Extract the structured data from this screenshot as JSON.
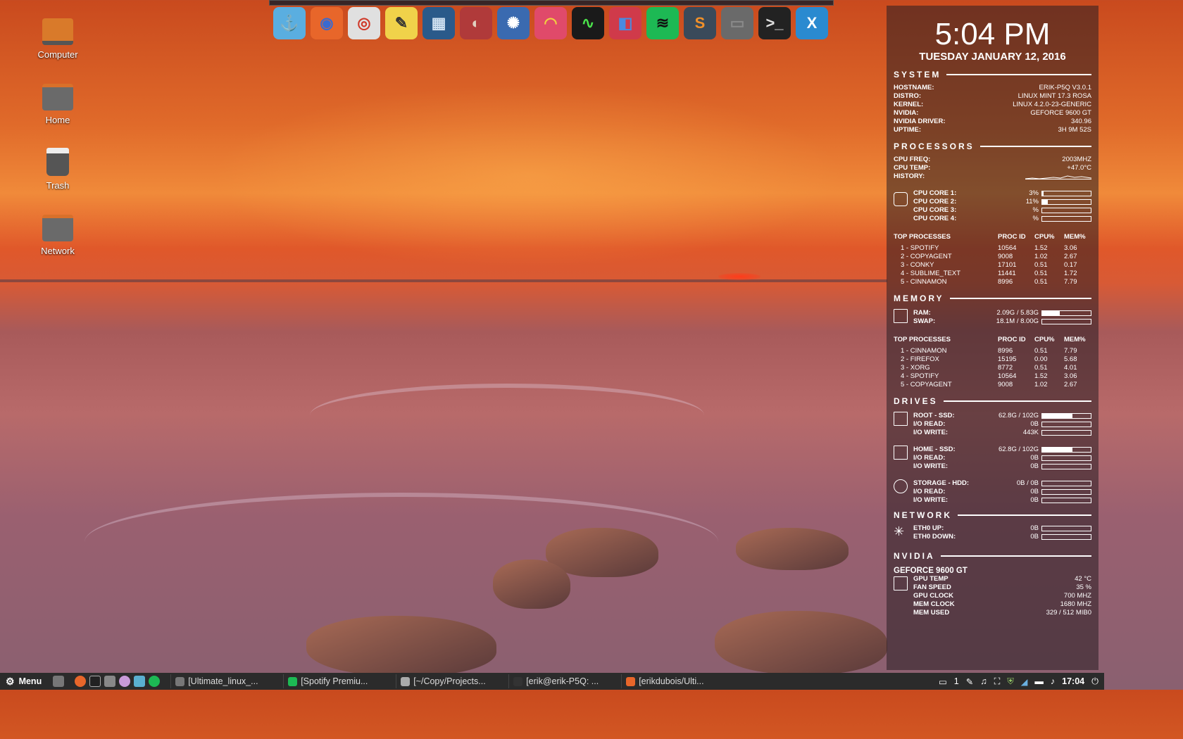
{
  "desktop": {
    "icons": [
      {
        "label": "Computer"
      },
      {
        "label": "Home"
      },
      {
        "label": "Trash"
      },
      {
        "label": "Network"
      }
    ]
  },
  "dock": {
    "icons": [
      {
        "name": "anchor-icon",
        "glyph": "⚓",
        "color": "#5aaee0",
        "fg": "#ffffff"
      },
      {
        "name": "firefox-icon",
        "glyph": "◉",
        "color": "#e8662a",
        "fg": "#3a6ad0"
      },
      {
        "name": "chrome-icon",
        "glyph": "◎",
        "color": "#e0e0e0",
        "fg": "#d03a2a"
      },
      {
        "name": "notes-icon",
        "glyph": "✎",
        "color": "#f0d24a",
        "fg": "#333333"
      },
      {
        "name": "video-icon",
        "glyph": "▦",
        "color": "#2a5a8a",
        "fg": "#cfe0f0"
      },
      {
        "name": "photo-viewer-icon",
        "glyph": "◐",
        "color": "#b03a3a",
        "fg": "#e0d0c0"
      },
      {
        "name": "shutter-icon",
        "glyph": "✺",
        "color": "#3a6ab0",
        "fg": "#ffffff"
      },
      {
        "name": "rainbow-icon",
        "glyph": "◠",
        "color": "#e04a6a",
        "fg": "#f0d040"
      },
      {
        "name": "system-monitor-icon",
        "glyph": "∿",
        "color": "#1a1a1a",
        "fg": "#4ae04a"
      },
      {
        "name": "tools-icon",
        "glyph": "◧",
        "color": "#d03a4a",
        "fg": "#4a8ae0"
      },
      {
        "name": "spotify-icon",
        "glyph": "≋",
        "color": "#1db954",
        "fg": "#111111"
      },
      {
        "name": "sublime-icon",
        "glyph": "S",
        "color": "#3a4a5a",
        "fg": "#f0902a"
      },
      {
        "name": "folder-icon",
        "glyph": "▭",
        "color": "#6a6a6a",
        "fg": "#8a8a8a"
      },
      {
        "name": "terminal-icon",
        "glyph": ">_",
        "color": "#222222",
        "fg": "#e0e0e0"
      },
      {
        "name": "xapp-icon",
        "glyph": "X",
        "color": "#2a8ad0",
        "fg": "#ffffff"
      }
    ]
  },
  "conky": {
    "time": "5:04 PM",
    "date": "TUESDAY JANUARY 12, 2016",
    "system": {
      "title": "SYSTEM",
      "rows": [
        {
          "k": "HOSTNAME:",
          "v": "ERIK-P5Q  V3.0.1"
        },
        {
          "k": "DISTRO:",
          "v": "LINUX MINT 17.3 ROSA"
        },
        {
          "k": "KERNEL:",
          "v": "LINUX 4.2.0-23-GENERIC"
        },
        {
          "k": "NVIDIA:",
          "v": "GEFORCE 9600 GT"
        },
        {
          "k": "NVIDIA DRIVER:",
          "v": "340.96"
        },
        {
          "k": "UPTIME:",
          "v": "3H 9M 52S"
        }
      ]
    },
    "processors": {
      "title": "PROCESSORS",
      "cpu_freq_label": "CPU FREQ:",
      "cpu_freq": "2003MHZ",
      "cpu_temp_label": "CPU TEMP:",
      "cpu_temp": "+47.0°C",
      "history_label": "HISTORY:",
      "cores": [
        {
          "label": "CPU CORE 1:",
          "value": "3%",
          "pct": 3
        },
        {
          "label": "CPU CORE 2:",
          "value": "11%",
          "pct": 11
        },
        {
          "label": "CPU CORE 3:",
          "value": "%",
          "pct": 0
        },
        {
          "label": "CPU CORE 4:",
          "value": "%",
          "pct": 0
        }
      ],
      "top_header": [
        "TOP PROCESSES",
        "PROC ID",
        "CPU%",
        "MEM%"
      ],
      "top": [
        [
          "1 - SPOTIFY",
          "10564",
          "1.52",
          "3.06"
        ],
        [
          "2 - COPYAGENT",
          "9008",
          "1.02",
          "2.67"
        ],
        [
          "3 - CONKY",
          "17101",
          "0.51",
          "0.17"
        ],
        [
          "4 - SUBLIME_TEXT",
          "11441",
          "0.51",
          "1.72"
        ],
        [
          "5 - CINNAMON",
          "8996",
          "0.51",
          "7.79"
        ]
      ]
    },
    "memory": {
      "title": "MEMORY",
      "ram_label": "RAM:",
      "ram": "2.09G / 5.83G",
      "ram_pct": 36,
      "swap_label": "SWAP:",
      "swap": "18.1M / 8.00G",
      "swap_pct": 0,
      "top_header": [
        "TOP PROCESSES",
        "PROC ID",
        "CPU%",
        "MEM%"
      ],
      "top": [
        [
          "1 - CINNAMON",
          "8996",
          "0.51",
          "7.79"
        ],
        [
          "2 - FIREFOX",
          "15195",
          "0.00",
          "5.68"
        ],
        [
          "3 - XORG",
          "8772",
          "0.51",
          "4.01"
        ],
        [
          "4 - SPOTIFY",
          "10564",
          "1.52",
          "3.06"
        ],
        [
          "5 - COPYAGENT",
          "9008",
          "1.02",
          "2.67"
        ]
      ]
    },
    "drives": {
      "title": "DRIVES",
      "groups": [
        {
          "rows": [
            {
              "k": "ROOT - SSD:",
              "v": "62.8G / 102G",
              "pct": 62
            },
            {
              "k": "I/O READ:",
              "v": "0B",
              "pct": 0
            },
            {
              "k": "I/O WRITE:",
              "v": "443K",
              "pct": 0
            }
          ]
        },
        {
          "rows": [
            {
              "k": "HOME - SSD:",
              "v": "62.8G / 102G",
              "pct": 62
            },
            {
              "k": "I/O READ:",
              "v": "0B",
              "pct": 0
            },
            {
              "k": "I/O WRITE:",
              "v": "0B",
              "pct": 0
            }
          ]
        },
        {
          "rows": [
            {
              "k": "STORAGE - HDD:",
              "v": "0B / 0B",
              "pct": 0
            },
            {
              "k": "I/O READ:",
              "v": "0B",
              "pct": 0
            },
            {
              "k": "I/O WRITE:",
              "v": "0B",
              "pct": 0
            }
          ]
        }
      ]
    },
    "network": {
      "title": "NETWORK",
      "rows": [
        {
          "k": "ETH0 UP:",
          "v": "0B"
        },
        {
          "k": "ETH0 DOWN:",
          "v": "0B"
        }
      ]
    },
    "nvidia": {
      "title": "NVIDIA",
      "card": "GEFORCE 9600 GT",
      "rows": [
        {
          "k": "GPU TEMP",
          "v": "42 °C"
        },
        {
          "k": "FAN SPEED",
          "v": "35 %"
        },
        {
          "k": "GPU CLOCK",
          "v": "700 MHZ"
        },
        {
          "k": "MEM CLOCK",
          "v": "1680 MHZ"
        },
        {
          "k": "MEM USED",
          "v": "329 / 512 MIB0"
        }
      ]
    }
  },
  "taskbar": {
    "menu_label": "Menu",
    "windows": [
      {
        "label": "[Ultimate_linux_...",
        "icon_color": "#777777"
      },
      {
        "label": "[Spotify Premiu...",
        "icon_color": "#1db954"
      },
      {
        "label": "[~/Copy/Projects...",
        "icon_color": "#aaaaaa"
      },
      {
        "label": "[erik@erik-P5Q: ...",
        "icon_color": "#333333"
      },
      {
        "label": "[erikdubois/Ulti...",
        "icon_color": "#e8662a"
      }
    ],
    "workspace": "1",
    "clock": "17:04"
  }
}
